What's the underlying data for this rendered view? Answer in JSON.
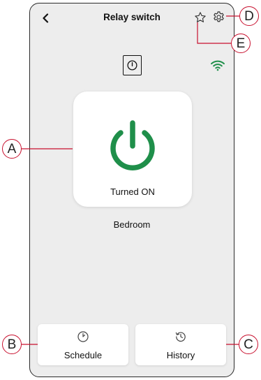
{
  "header": {
    "title": "Relay switch",
    "back_icon": "chevron-left-icon",
    "favorite_icon": "star-outline-icon",
    "settings_icon": "gear-icon"
  },
  "device": {
    "type_icon": "power-switch-icon",
    "connection_icon": "wifi-icon",
    "connection_color": "#1f8f4a"
  },
  "power_card": {
    "icon": "power-icon",
    "icon_color": "#1f8f4a",
    "status": "Turned ON"
  },
  "room": "Bedroom",
  "actions": {
    "schedule": {
      "label": "Schedule",
      "icon": "clock-icon"
    },
    "history": {
      "label": "History",
      "icon": "history-icon"
    }
  },
  "callouts": {
    "a": "A",
    "b": "B",
    "c": "C",
    "d": "D",
    "e": "E",
    "color": "#c8102e"
  }
}
